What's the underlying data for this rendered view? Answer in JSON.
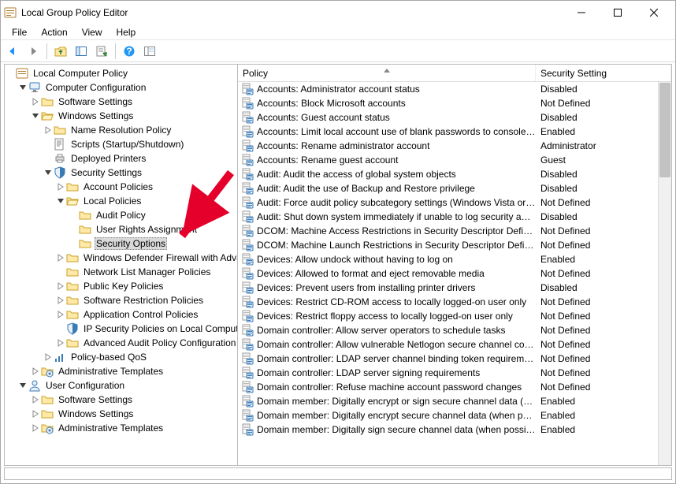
{
  "window": {
    "title": "Local Group Policy Editor"
  },
  "menu": [
    "File",
    "Action",
    "View",
    "Help"
  ],
  "tree_root": "Local Computer Policy",
  "tree": {
    "cc": "Computer Configuration",
    "ss": "Software Settings",
    "ws": "Windows Settings",
    "nrp": "Name Resolution Policy",
    "scr": "Scripts (Startup/Shutdown)",
    "dp": "Deployed Printers",
    "secset": "Security Settings",
    "ap": "Account Policies",
    "lp": "Local Policies",
    "audit": "Audit Policy",
    "ura": "User Rights Assignment",
    "secopt": "Security Options",
    "wdf": "Windows Defender Firewall with Advanced Security",
    "nlmp": "Network List Manager Policies",
    "pkp": "Public Key Policies",
    "srp": "Software Restriction Policies",
    "acp": "Application Control Policies",
    "ipsec": "IP Security Policies on Local Computer",
    "aapc": "Advanced Audit Policy Configuration",
    "qos": "Policy-based QoS",
    "at": "Administrative Templates",
    "uc": "User Configuration",
    "uss": "Software Settings",
    "uws": "Windows Settings",
    "uat": "Administrative Templates"
  },
  "columns": {
    "policy": "Policy",
    "security": "Security Setting"
  },
  "policies": [
    {
      "n": "Accounts: Administrator account status",
      "s": "Disabled"
    },
    {
      "n": "Accounts: Block Microsoft accounts",
      "s": "Not Defined"
    },
    {
      "n": "Accounts: Guest account status",
      "s": "Disabled"
    },
    {
      "n": "Accounts: Limit local account use of blank passwords to console logon only",
      "s": "Enabled"
    },
    {
      "n": "Accounts: Rename administrator account",
      "s": "Administrator"
    },
    {
      "n": "Accounts: Rename guest account",
      "s": "Guest"
    },
    {
      "n": "Audit: Audit the access of global system objects",
      "s": "Disabled"
    },
    {
      "n": "Audit: Audit the use of Backup and Restore privilege",
      "s": "Disabled"
    },
    {
      "n": "Audit: Force audit policy subcategory settings (Windows Vista or later) to override",
      "s": "Not Defined"
    },
    {
      "n": "Audit: Shut down system immediately if unable to log security audits",
      "s": "Disabled"
    },
    {
      "n": "DCOM: Machine Access Restrictions in Security Descriptor Definition Language",
      "s": "Not Defined"
    },
    {
      "n": "DCOM: Machine Launch Restrictions in Security Descriptor Definition Language",
      "s": "Not Defined"
    },
    {
      "n": "Devices: Allow undock without having to log on",
      "s": "Enabled"
    },
    {
      "n": "Devices: Allowed to format and eject removable media",
      "s": "Not Defined"
    },
    {
      "n": "Devices: Prevent users from installing printer drivers",
      "s": "Disabled"
    },
    {
      "n": "Devices: Restrict CD-ROM access to locally logged-on user only",
      "s": "Not Defined"
    },
    {
      "n": "Devices: Restrict floppy access to locally logged-on user only",
      "s": "Not Defined"
    },
    {
      "n": "Domain controller: Allow server operators to schedule tasks",
      "s": "Not Defined"
    },
    {
      "n": "Domain controller: Allow vulnerable Netlogon secure channel connections",
      "s": "Not Defined"
    },
    {
      "n": "Domain controller: LDAP server channel binding token requirements",
      "s": "Not Defined"
    },
    {
      "n": "Domain controller: LDAP server signing requirements",
      "s": "Not Defined"
    },
    {
      "n": "Domain controller: Refuse machine account password changes",
      "s": "Not Defined"
    },
    {
      "n": "Domain member: Digitally encrypt or sign secure channel data (always)",
      "s": "Enabled"
    },
    {
      "n": "Domain member: Digitally encrypt secure channel data (when possible)",
      "s": "Enabled"
    },
    {
      "n": "Domain member: Digitally sign secure channel data (when possible)",
      "s": "Enabled"
    }
  ]
}
